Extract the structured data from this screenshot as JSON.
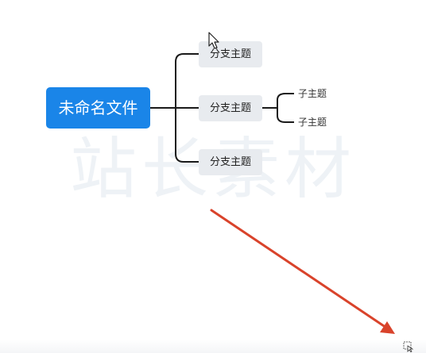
{
  "mindmap": {
    "watermark_text": "站长素材",
    "root": {
      "label": "未命名文件"
    },
    "branches": [
      {
        "label": "分支主题"
      },
      {
        "label": "分支主题",
        "children": [
          {
            "label": "子主题"
          },
          {
            "label": "子主题"
          }
        ]
      },
      {
        "label": "分支主题"
      }
    ]
  },
  "colors": {
    "root_fill": "#1a85e8",
    "branch_fill": "#e8ebef",
    "connector": "#1a1a1a",
    "annotation_arrow": "#d9432b"
  },
  "icons": {
    "cursor": "mouse-pointer-icon",
    "annotation": "arrow-icon",
    "corner": "resize-select-icon"
  }
}
